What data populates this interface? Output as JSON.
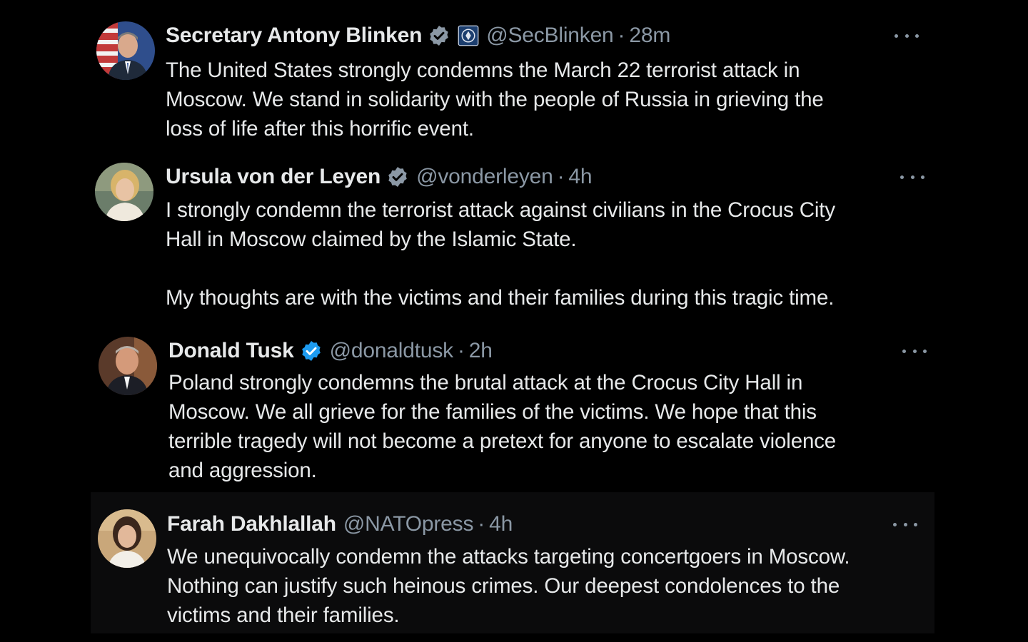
{
  "tweets": [
    {
      "name": "Secretary Antony Blinken",
      "handle": "@SecBlinken",
      "time": "28m",
      "body": "The United States strongly condemns the March 22 terrorist attack in\nMoscow.  We stand in solidarity with the people of Russia in grieving the\nloss of life after this horrific event.",
      "verified": true,
      "government_badge": "us-state-department-seal-icon"
    },
    {
      "name": "Ursula von der Leyen",
      "handle": "@vonderleyen",
      "time": "4h",
      "body": "I strongly condemn the terrorist attack against civilians in the Crocus City\nHall in Moscow claimed by the Islamic State.\n\nMy thoughts are with the victims and their families during this tragic time.",
      "verified": true
    },
    {
      "name": "Donald Tusk",
      "handle": "@donaldtusk",
      "time": "2h",
      "body": "Poland strongly condemns the brutal attack at the Crocus City Hall in\nMoscow. We all grieve for the families of the victims. We hope that this\nterrible tragedy will not become a pretext for anyone to escalate violence\nand aggression.",
      "verified": true
    },
    {
      "name": "Farah Dakhlallah",
      "handle": "@NATOpress",
      "time": "4h",
      "body": "We unequivocally condemn the attacks targeting concertgoers in Moscow.\nNothing can justify such heinous crimes. Our deepest condolences to the\nvictims and their families.",
      "verified": false
    }
  ],
  "separator": "·",
  "colors": {
    "background": "#000000",
    "text": "#e7e9ea",
    "muted": "#8b98a5",
    "verified": "#1d9bf0"
  }
}
